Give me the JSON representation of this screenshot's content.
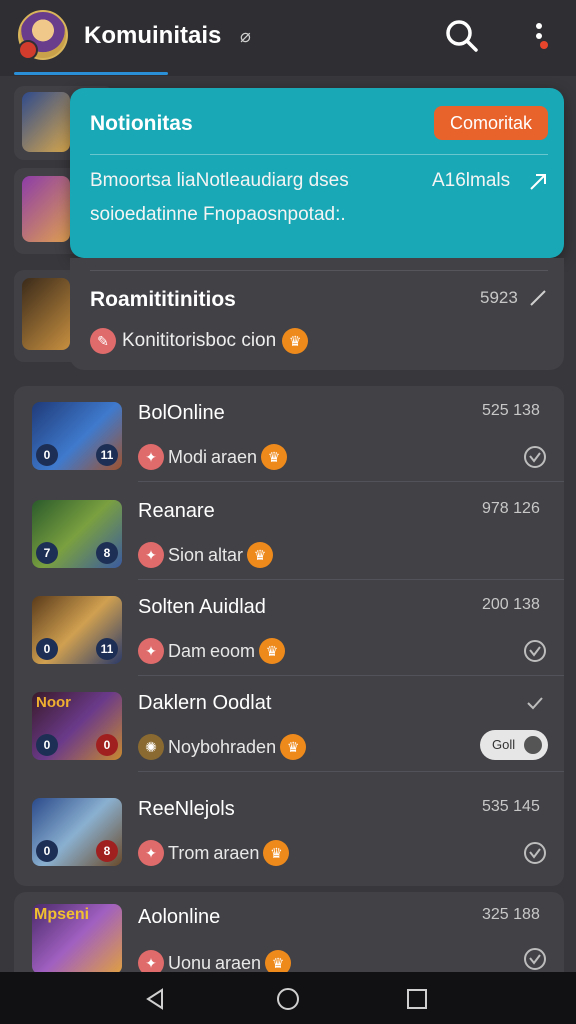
{
  "header": {
    "title": "Komuinitais",
    "title_suffix": "⌀",
    "search_icon": "search-icon",
    "menu_icon": "more-vert-icon"
  },
  "notification": {
    "title": "Notionitas",
    "button_label": "Comoritak",
    "line1": "Bmoortsa liaNotleaudiarg dses",
    "line2": "soioedatinne Fnopaosnpotad:.",
    "meta": "A16lmals",
    "accent": "#19a8b5",
    "button_color": "#e8622c"
  },
  "panel": {
    "title": "Roamititinitios",
    "count": "5923",
    "subtitle": "Konititorisboc cion"
  },
  "list": [
    {
      "name": "BolOnline",
      "count": "525 138",
      "sub": "Modi",
      "sub2": "araen",
      "lv_left": "0",
      "lv_right": "11",
      "trailing": "check-circle"
    },
    {
      "name": "Reanare",
      "count": "978 126",
      "sub": "Sion",
      "sub2": "altar",
      "lv_left": "7",
      "lv_right": "8",
      "trailing": "none"
    },
    {
      "name": "Solten Auidlad",
      "count": "200 138",
      "sub": "Dam",
      "sub2": "eoom",
      "lv_left": "0",
      "lv_right": "11",
      "trailing": "check-circle"
    },
    {
      "name": "Daklern Oodlat",
      "count": "",
      "sub": "Noybohraden",
      "sub2": "",
      "lv_left": "0",
      "lv_right": "0",
      "trailing": "toggle",
      "toggle_label": "Goll"
    },
    {
      "name": "ReeNlejols",
      "count": "535 145",
      "sub": "Trom",
      "sub2": "araen",
      "lv_left": "0",
      "lv_right": "8",
      "trailing": "check-circle"
    }
  ],
  "last_item": {
    "name": "Aolonline",
    "count": "325 188",
    "sub": "Uonu",
    "sub2": "araen",
    "thumb_label": "Mpseni"
  },
  "thumb_label_row4": "Noor",
  "navbar": {
    "back_icon": "back-triangle-icon",
    "home_icon": "home-circle-icon",
    "recents_icon": "recents-square-icon"
  }
}
